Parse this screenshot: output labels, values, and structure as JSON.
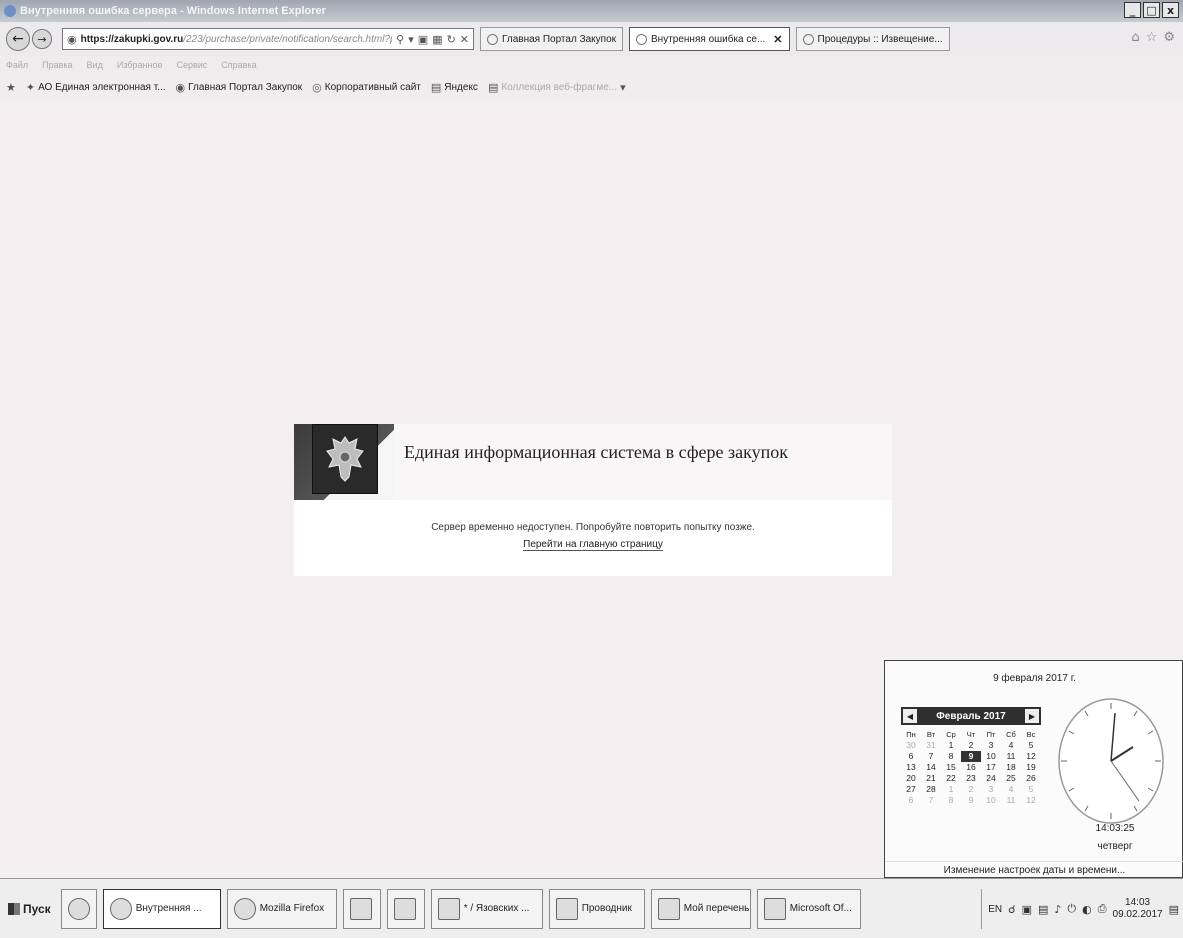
{
  "window": {
    "title": "Внутренняя ошибка сервера - Windows Internet Explorer",
    "buttons": [
      "_",
      "□",
      "x"
    ]
  },
  "address": {
    "url_host": "https://zakupki.gov.ru",
    "url_rest": "/223/purchase/private/notification/search.html?purchaseSt"
  },
  "tabs": [
    {
      "label": "Главная Портал Закупок"
    },
    {
      "label": "Внутренняя ошибка се..."
    },
    {
      "label": "Процедуры :: Извещение..."
    }
  ],
  "menu": [
    "Файл",
    "Правка",
    "Вид",
    "Избранное",
    "Сервис",
    "Справка"
  ],
  "favorites": [
    {
      "label": "АО Единая электронная т..."
    },
    {
      "label": "Главная Портал Закупок"
    },
    {
      "label": "Корпоративный сайт"
    },
    {
      "label": "Яндекс"
    },
    {
      "label": "Коллекция веб-фрагме..."
    }
  ],
  "page": {
    "title": "Единая информационная система в сфере закупок",
    "message": "Сервер временно недоступен. Попробуйте повторить попытку позже.",
    "link": "Перейти на главную страницу"
  },
  "calendar": {
    "date_full": "9 февраля 2017 г.",
    "month_label": "Февраль 2017",
    "weekdays": [
      "Пн",
      "Вт",
      "Ср",
      "Чт",
      "Пт",
      "Сб",
      "Вс"
    ],
    "weeks": [
      [
        "30",
        "31",
        "1",
        "2",
        "3",
        "4",
        "5"
      ],
      [
        "6",
        "7",
        "8",
        "9",
        "10",
        "11",
        "12"
      ],
      [
        "13",
        "14",
        "15",
        "16",
        "17",
        "18",
        "19"
      ],
      [
        "20",
        "21",
        "22",
        "23",
        "24",
        "25",
        "26"
      ],
      [
        "27",
        "28",
        "1",
        "2",
        "3",
        "4",
        "5"
      ],
      [
        "6",
        "7",
        "8",
        "9",
        "10",
        "11",
        "12"
      ]
    ],
    "today": "9",
    "time": "14:03:25",
    "day_name": "четверг",
    "settings_link": "Изменение настроек даты и времени..."
  },
  "taskbar": {
    "start_label": "Пуск",
    "items": [
      {
        "label": "Внутренняя ..."
      },
      {
        "label": "Mozilla Firefox"
      },
      {
        "label": "* / Язовских ..."
      },
      {
        "label": "Проводник"
      },
      {
        "label": "Мой перечень"
      },
      {
        "label": "Microsoft Of..."
      }
    ],
    "lang": "EN",
    "clock_time": "14:03",
    "clock_date": "09.02.2017"
  }
}
